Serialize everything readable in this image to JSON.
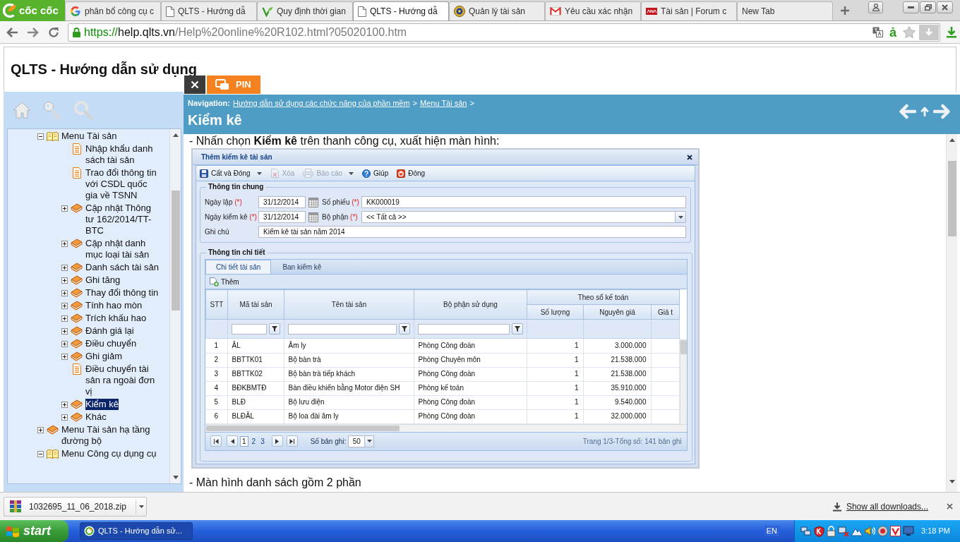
{
  "browser": {
    "logo": "cốc cốc",
    "tabs": [
      {
        "title": "phân bổ công cụ c",
        "kind": "google",
        "selected": false
      },
      {
        "title": "QLTS - Hướng dẫ",
        "kind": "page",
        "selected": false
      },
      {
        "title": "Quy định thời gian",
        "kind": "leaf",
        "selected": false
      },
      {
        "title": "QLTS - Hướng dẫ",
        "kind": "page",
        "selected": true
      },
      {
        "title": "Quản lý tài sản",
        "kind": "emblem",
        "selected": false
      },
      {
        "title": "Yêu cầu xác nhận",
        "kind": "mail",
        "selected": false
      },
      {
        "title": "Tài sản | Forum c",
        "kind": "banner",
        "selected": false
      },
      {
        "title": "New Tab",
        "kind": "blank",
        "selected": false
      }
    ],
    "address": {
      "scheme": "https://",
      "host": "help.qlts.vn",
      "path": "/Help%20online%20R102.html?05020100.htm"
    },
    "input_method": "ả"
  },
  "header": {
    "title": "QLTS - Hướng dẫn sử dụng"
  },
  "sidebar": {
    "tree": [
      {
        "label": "Menu Tài sản",
        "kind": "folder",
        "expanded": true,
        "selected": false,
        "children": [
          {
            "label": "Nhập khẩu danh sách tài sản",
            "kind": "page",
            "selected": false
          },
          {
            "label": "Trao đổi thông tin với CSDL quốc gia về TSNN",
            "kind": "page",
            "selected": false
          },
          {
            "label": "Cập nhật Thông tư 162/2014/TT-BTC",
            "kind": "folder",
            "expanded": false,
            "selected": false
          },
          {
            "label": "Cập nhật danh mục loại tài sản",
            "kind": "folder",
            "expanded": false,
            "selected": false
          },
          {
            "label": "Danh sách tài sản",
            "kind": "folder",
            "expanded": false,
            "selected": false
          },
          {
            "label": "Ghi tăng",
            "kind": "folder",
            "expanded": false,
            "selected": false
          },
          {
            "label": "Thay đổi thông tin",
            "kind": "folder",
            "expanded": false,
            "selected": false
          },
          {
            "label": "Tính hao mòn",
            "kind": "folder",
            "expanded": false,
            "selected": false
          },
          {
            "label": "Trích khấu hao",
            "kind": "folder",
            "expanded": false,
            "selected": false
          },
          {
            "label": "Đánh giá lại",
            "kind": "folder",
            "expanded": false,
            "selected": false
          },
          {
            "label": "Điều chuyển",
            "kind": "folder",
            "expanded": false,
            "selected": false
          },
          {
            "label": "Ghi giảm",
            "kind": "folder",
            "expanded": false,
            "selected": false
          },
          {
            "label": "Điều chuyển tài sản ra ngoài đơn vị",
            "kind": "page",
            "selected": false
          },
          {
            "label": "Kiểm kê",
            "kind": "folder",
            "expanded": false,
            "selected": true
          },
          {
            "label": "Khác",
            "kind": "folder",
            "expanded": false,
            "selected": false
          }
        ]
      },
      {
        "label": "Menu Tài sản hạ tầng đường bộ",
        "kind": "folder",
        "expanded": false,
        "selected": false
      },
      {
        "label": "Menu Công cụ dụng cụ",
        "kind": "folder",
        "expanded": true,
        "selected": false
      }
    ]
  },
  "content": {
    "pin_button": "PIN",
    "navigation": {
      "label": "Navigation:",
      "links": [
        {
          "label": "Hướng dẫn sử dụng các chức năng của phần mềm",
          "separator": ">"
        },
        {
          "label": "Menu Tài sản",
          "separator": ">"
        }
      ]
    },
    "title": "Kiểm kê",
    "intro": "- Nhấn chọn **Kiểm kê** trên thanh công cụ, xuất hiện màn hình:",
    "dialog": {
      "title": "Thêm kiểm kê tài sản",
      "toolbar": [
        {
          "label": "Cất và Đóng",
          "kind": "save",
          "dropdown": true,
          "disabled": false
        },
        {
          "label": "Xóa",
          "kind": "delete",
          "dropdown": false,
          "disabled": true
        },
        {
          "label": "Báo cáo",
          "kind": "report",
          "dropdown": true,
          "disabled": true
        },
        {
          "label": "Giúp",
          "kind": "help",
          "dropdown": false,
          "disabled": false
        },
        {
          "label": "Đóng",
          "kind": "close",
          "dropdown": false,
          "disabled": false
        }
      ],
      "general": {
        "legend": "Thông tin chung",
        "rows": [
          [
            {
              "label": "Ngày lập",
              "required": "(*)",
              "value": "31/12/2014",
              "kind": "date"
            },
            {
              "label": "Số phiếu",
              "required": "(*)",
              "value": "KK000019",
              "kind": "text"
            }
          ],
          [
            {
              "label": "Ngày kiểm kê",
              "required": "(*)",
              "value": "31/12/2014",
              "kind": "date"
            },
            {
              "label": "Bộ phận",
              "required": "(*)",
              "value": "<< Tất cả >>",
              "kind": "select"
            }
          ],
          [
            {
              "label": "Ghi chú",
              "value": "Kiểm kê tài sản năm 2014",
              "kind": "text"
            }
          ]
        ]
      },
      "detail": {
        "legend": "Thông tin chi tiết",
        "tabs": [
          {
            "label": "Chi tiết tài sản",
            "selected": true
          },
          {
            "label": "Ban kiểm kê",
            "selected": false
          }
        ],
        "add_button": "Thêm",
        "columns": [
          {
            "label": "STT",
            "filter": false
          },
          {
            "label": "Mã tài sản",
            "filter": true
          },
          {
            "label": "Tên tài sản",
            "filter": true
          },
          {
            "label": "Bộ phận sử dụng",
            "filter": true
          },
          {
            "label": "Theo sổ kế toán",
            "colspan": 3,
            "children": [
              {
                "label": "Số lượng",
                "filter": false
              },
              {
                "label": "Nguyên giá",
                "filter": false
              },
              {
                "label": "Giá t",
                "filter": false
              }
            ]
          }
        ],
        "rows": [
          [
            "1",
            "ÂL",
            "Âm ly",
            "Phòng Công đoàn",
            "1",
            "3.000.000"
          ],
          [
            "2",
            "BBTTK01",
            "Bộ bàn trà",
            "Phòng Chuyên môn",
            "1",
            "21.538.000"
          ],
          [
            "3",
            "BBTTK02",
            "Bộ bàn trà tiếp khách",
            "Phòng Công đoàn",
            "1",
            "21.538.000"
          ],
          [
            "4",
            "BĐKBMTĐ",
            "Bàn điều khiển bằng Motor điện SH",
            "Phòng kế toán",
            "1",
            "35.910.000"
          ],
          [
            "5",
            "BLĐ",
            "Bộ lưu điện",
            "Phòng Công đoàn",
            "1",
            "9.540.000"
          ],
          [
            "6",
            "BLĐÂL",
            "Bộ loa đài âm ly",
            "Phòng Công đoàn",
            "1",
            "32.000.000"
          ]
        ],
        "pager": {
          "pages": [
            {
              "label": "1",
              "selected": true
            },
            {
              "label": "2",
              "selected": false
            },
            {
              "label": "3",
              "selected": false
            }
          ],
          "size_label": "Số bản ghi:",
          "size": "50",
          "summary": "Trang 1/3-Tổng số: 141 bản ghi"
        }
      }
    },
    "outro": "- Màn hình danh sách gồm 2 phần"
  },
  "downloads": {
    "file": "1032695_11_06_2018.zip",
    "show_all": "Show all downloads..."
  },
  "taskbar": {
    "start": "start",
    "tasks": [
      {
        "label": "QLTS - Hướng dẫn sử...",
        "selected": true
      }
    ],
    "language": "EN",
    "clock": "3:18 PM"
  }
}
